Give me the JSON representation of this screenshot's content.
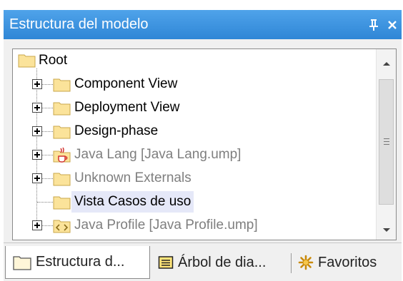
{
  "panel": {
    "title": "Estructura del modelo",
    "pin_glyph": "ᵽ",
    "close_glyph": "✕"
  },
  "tree": {
    "items": [
      {
        "label": "Root",
        "icon": "folder-icon",
        "expandable": false,
        "dimmed": false,
        "selected": false
      },
      {
        "label": "Component View",
        "icon": "folder-icon",
        "expandable": true,
        "dimmed": false,
        "selected": false
      },
      {
        "label": "Deployment View",
        "icon": "folder-icon",
        "expandable": true,
        "dimmed": false,
        "selected": false
      },
      {
        "label": "Design-phase",
        "icon": "folder-icon",
        "expandable": true,
        "dimmed": false,
        "selected": false
      },
      {
        "label": "Java Lang [Java Lang.ump]",
        "icon": "java-package-icon",
        "expandable": true,
        "dimmed": true,
        "selected": false
      },
      {
        "label": "Unknown Externals",
        "icon": "folder-icon",
        "expandable": true,
        "dimmed": true,
        "selected": false
      },
      {
        "label": "Vista Casos de uso",
        "icon": "folder-icon",
        "expandable": false,
        "dimmed": false,
        "selected": true
      },
      {
        "label": "Java Profile [Java Profile.ump]",
        "icon": "profile-package-icon",
        "expandable": true,
        "dimmed": true,
        "selected": false
      }
    ]
  },
  "tabs": [
    {
      "label": "Estructura d...",
      "icon": "model-tree-icon",
      "active": true
    },
    {
      "label": "Árbol de dia...",
      "icon": "diagram-tree-icon",
      "active": false
    },
    {
      "label": "Favoritos",
      "icon": "favorites-icon",
      "active": false
    }
  ],
  "colors": {
    "title_bar": "#3a8fdc",
    "folder": "#fbe39a",
    "selection": "#e5e8f8",
    "dimmed_text": "#7f7f7f"
  }
}
